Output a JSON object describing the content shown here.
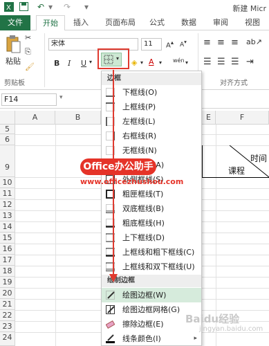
{
  "titlebar": {
    "title": "新建 Micr"
  },
  "tabs": [
    "文件",
    "开始",
    "插入",
    "页面布局",
    "公式",
    "数据",
    "审阅",
    "视图"
  ],
  "ribbon": {
    "paste_label": "粘贴",
    "clipboard_label": "剪贴板",
    "font_name": "宋体",
    "font_size": "11",
    "bold": "B",
    "italic": "I",
    "underline": "U",
    "font_color_glyph": "A",
    "wen_glyph": "wén",
    "align_label": "对齐方式"
  },
  "formula_bar": {
    "namebox": "F14"
  },
  "columns": [
    "A",
    "B",
    "E",
    "F"
  ],
  "rows": [
    "5",
    "6",
    "9",
    "10",
    "11",
    "12",
    "13",
    "14",
    "15",
    "16",
    "17",
    "18",
    "19",
    "20",
    "21",
    "22",
    "23",
    "24"
  ],
  "cells": {
    "time": "时间",
    "course": "课程"
  },
  "border_menu": {
    "section1": "边框",
    "items": [
      "下框线(O)",
      "上框线(P)",
      "左框线(L)",
      "右框线(R)",
      "无框线(N)",
      "所有框线(A)",
      "外侧框线(S)",
      "粗匣框线(T)",
      "双底框线(B)",
      "粗底框线(H)",
      "上下框线(D)",
      "上框线和粗下框线(C)",
      "上框线和双下框线(U)"
    ],
    "section2": "绘制边框",
    "draw_items": [
      "绘图边框(W)",
      "绘图边框网格(G)",
      "擦除边框(E)",
      "线条颜色(I)"
    ]
  },
  "watermark": {
    "banner": "Office办公助手",
    "url": "www.officezhushou.com",
    "baidu": "Baidu经验",
    "baidu_url": "jingyan.baidu.com"
  },
  "colors": {
    "excel_green": "#217346",
    "highlight_red": "#e03a2f",
    "menu_hover": "#d6ebdc"
  }
}
